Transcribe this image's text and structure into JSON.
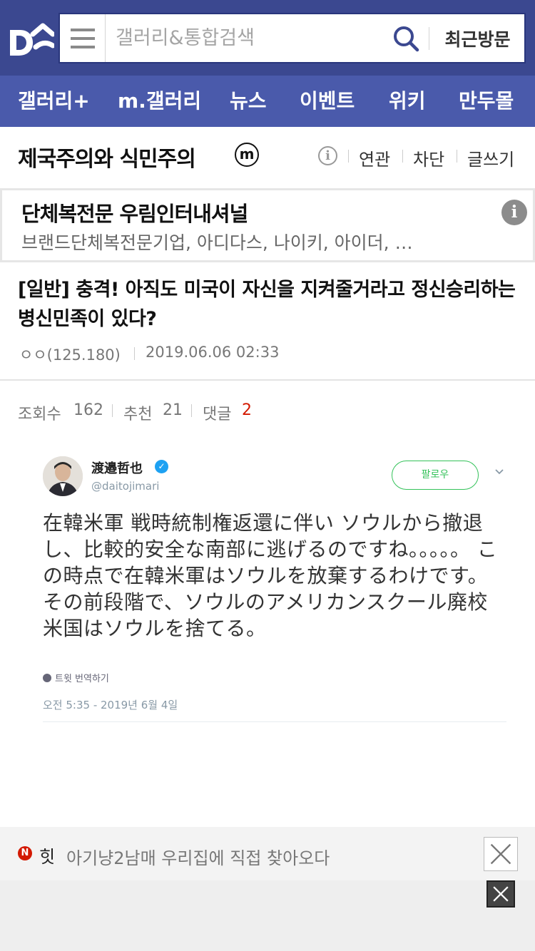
{
  "header": {
    "search_placeholder": "갤러리&통합검색",
    "recent_label": "최근방문",
    "brand_color": "#3b4890"
  },
  "nav": {
    "items": [
      {
        "label": "갤러리+"
      },
      {
        "label": "m.갤러리"
      },
      {
        "label": "뉴스"
      },
      {
        "label": "이벤트"
      },
      {
        "label": "위키"
      },
      {
        "label": "만두몰"
      }
    ]
  },
  "gallery": {
    "title": "제국주의와 식민주의",
    "badge": "m",
    "info_icon": "info-icon",
    "links": [
      "연관",
      "차단",
      "글쓰기"
    ]
  },
  "ad": {
    "title": "단체복전문 우림인터내셔널",
    "description": "브랜드단체복전문기업, 아디다스, 나이키, 아이더, …",
    "info": "i"
  },
  "post": {
    "title": "[일반] 충격! 아직도 미국이 자신을 지켜줄거라고 정신승리하는 병신민족이 있다?",
    "author": "ㅇㅇ(125.180)",
    "date": "2019.06.06 02:33",
    "views_label": "조회수",
    "views": "162",
    "recommend_label": "추천",
    "recommend": "21",
    "comments_label": "댓글",
    "comments": "2"
  },
  "tweet": {
    "name": "渡邉哲也",
    "handle": "@daitojimari",
    "follow_label": "팔로우",
    "text": "在韓米軍 戦時統制権返還に伴い ソウルから撤退し、比較的安全な南部に逃げるのですね。。。。。 この時点で在韓米軍はソウルを放棄するわけです。 その前段階で、ソウルのアメリカンスクール廃校 米国はソウルを捨てる。",
    "translate_label": "트윗 번역하기",
    "time": "오전 5:35 - 2019년 6월 4일"
  },
  "hit_bar": {
    "label": "힛",
    "text": "아기냥2남매 우리집에 직접 찾아오다",
    "logo_letter": "N"
  }
}
